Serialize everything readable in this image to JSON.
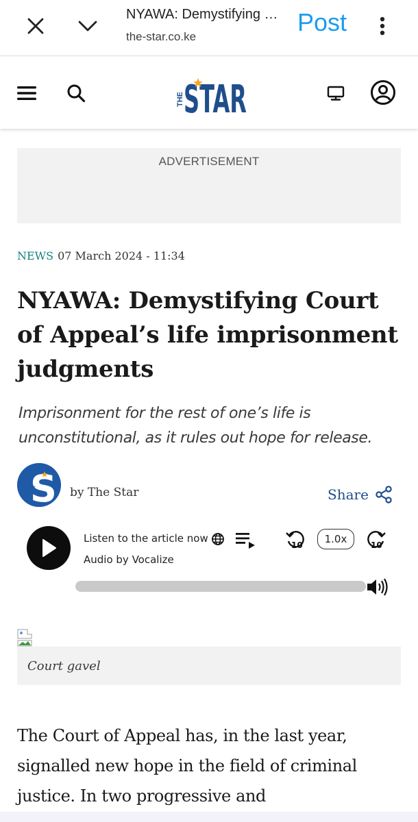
{
  "browser": {
    "page_title": "NYAWA: Demystifying Court of Appeal’s life imprisonment judgments",
    "url": "the-star.co.ke",
    "post_label": "Post",
    "icons": [
      "close-icon",
      "chevron-down-icon",
      "more-vert-icon"
    ]
  },
  "site_header": {
    "icons": [
      "menu-icon",
      "search-icon",
      "tv-icon",
      "account-icon"
    ],
    "logo": {
      "small": "THE",
      "main": "STAR",
      "color": "#1f4e8c",
      "accent": "#f5a623"
    }
  },
  "ad": {
    "label": "ADVERTISEMENT"
  },
  "article": {
    "category": "NEWS",
    "date": "07 March 2024 - 11:34",
    "headline": "NYAWA: Demystifying Court of Appeal’s life imprisonment judgments",
    "standfirst": "Imprisonment for the rest of one’s life is unconstitutional, as it rules out hope for release.",
    "byline": "by The Star",
    "share_label": "Share",
    "image_caption": "Court gavel",
    "body_text": "The Court of Appeal has, in the last year, signalled new hope in the field of criminal justice. In two progressive and"
  },
  "audio": {
    "listen_label": "Listen to the article now",
    "provider": "Audio by Vocalize",
    "speed": "1.0x",
    "rewind_seconds": "10",
    "forward_seconds": "10",
    "progress": 0
  },
  "colors": {
    "category": "#16827d",
    "share": "#1f4e8c",
    "post": "#1d9bf0"
  }
}
